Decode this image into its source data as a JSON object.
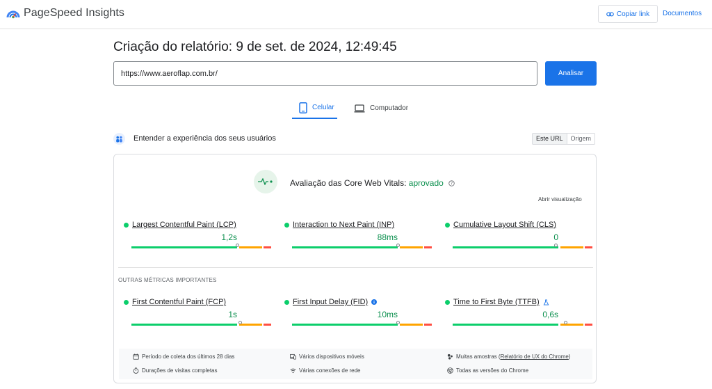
{
  "header": {
    "app_name": "PageSpeed Insights",
    "copy_link_label": "Copiar link",
    "docs_label": "Documentos"
  },
  "report": {
    "title": "Criação do relatório: 9 de set. de 2024, 12:49:45",
    "url_value": "https://www.aeroflap.com.br/",
    "analyze_label": "Analisar"
  },
  "tabs": [
    {
      "label": "Celular",
      "icon": "phone-icon",
      "active": true
    },
    {
      "label": "Computador",
      "icon": "laptop-icon",
      "active": false
    }
  ],
  "experience": {
    "title": "Entender a experiência dos seus usuários",
    "toggle": [
      "Este URL",
      "Origem"
    ]
  },
  "cwv": {
    "assessment_label": "Avaliação das Core Web Vitals: ",
    "assessment_status": "aprovado",
    "open_view_label": "Abrir visualização"
  },
  "metrics_core": [
    {
      "name": "Largest Contentful Paint (LCP)",
      "value": "1,2s",
      "marker": 0.76
    },
    {
      "name": "Interaction to Next Paint (INP)",
      "value": "88ms",
      "marker": 0.76
    },
    {
      "name": "Cumulative Layout Shift (CLS)",
      "value": "0",
      "marker": 0.74
    }
  ],
  "other_metrics_label": "OUTRAS MÉTRICAS IMPORTANTES",
  "metrics_other": [
    {
      "name": "First Contentful Paint (FCP)",
      "value": "1s",
      "marker": 0.78
    },
    {
      "name": "First Input Delay (FID)",
      "value": "10ms",
      "marker": 0.76
    },
    {
      "name": "Time to First Byte (TTFB)",
      "value": "0,6s",
      "marker": 0.81
    }
  ],
  "footer": {
    "period": "Período de coleta dos últimos 28 dias",
    "durations": "Durações de visitas completas",
    "devices": "Vários dispositivos móveis",
    "connections": "Várias conexões de rede",
    "samples_prefix": "Muitas amostras (",
    "samples_link": "Relatório de UX do Chrome",
    "samples_suffix": ")",
    "chrome_versions": "Todas as versões do Chrome"
  },
  "colors": {
    "accent": "#1a73e8",
    "good": "#0cce6b",
    "good_text": "#0d904f",
    "average": "#ffa400",
    "poor": "#ff4e42"
  }
}
